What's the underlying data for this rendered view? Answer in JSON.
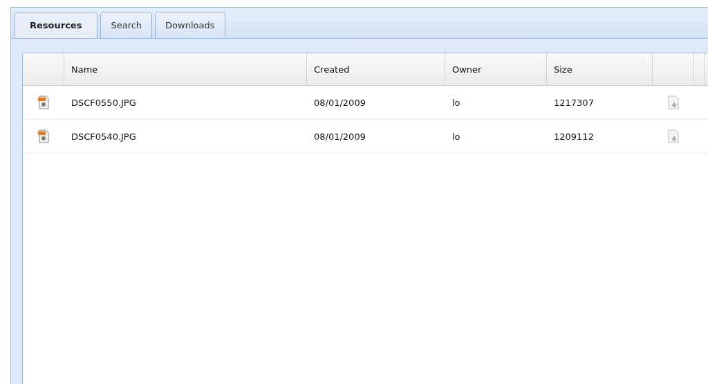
{
  "tabs": [
    {
      "label": "Resources",
      "selected": true
    },
    {
      "label": "Search",
      "selected": false
    },
    {
      "label": "Downloads",
      "selected": false
    }
  ],
  "table": {
    "columns": [
      "Name",
      "Created",
      "Owner",
      "Size"
    ],
    "rows": [
      {
        "name": "DSCF0550.JPG",
        "created": "08/01/2009",
        "owner": "lo",
        "size": "1217307"
      },
      {
        "name": "DSCF0540.JPG",
        "created": "08/01/2009",
        "owner": "lo",
        "size": "1209112"
      }
    ]
  }
}
